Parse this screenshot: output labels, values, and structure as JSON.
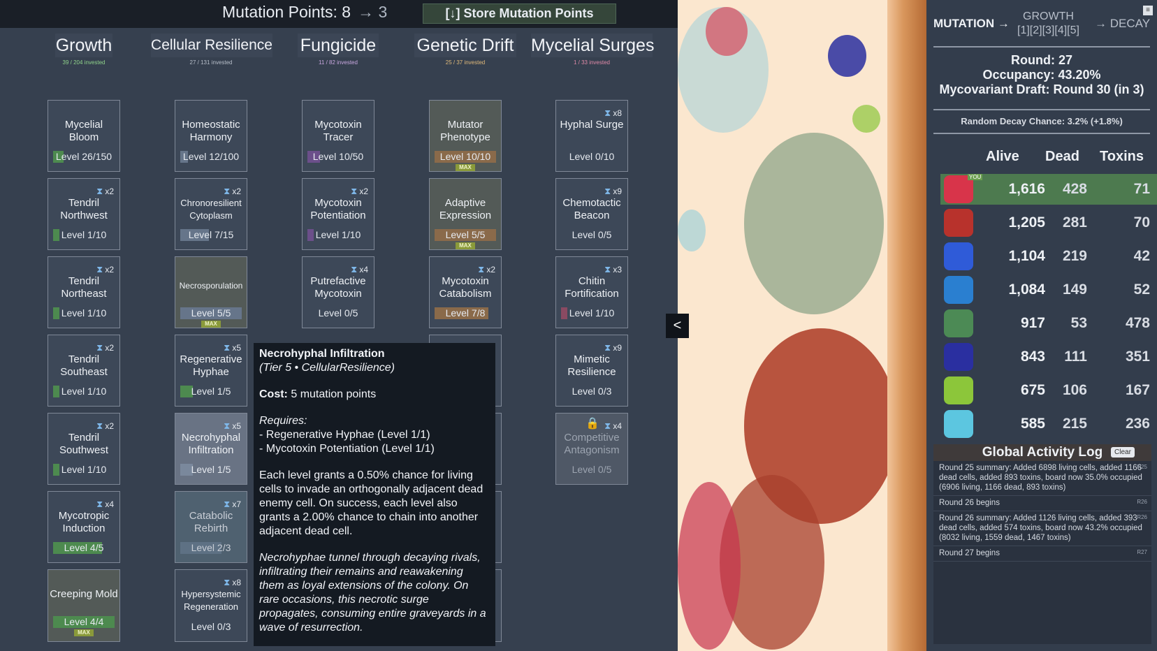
{
  "topbar": {
    "mutation_points_label": "Mutation Points: 8",
    "mutation_points_after": "→ 3",
    "store_button": "[↓] Store Mutation Points"
  },
  "columns": [
    {
      "title": "Growth",
      "invested": "39 / 204 invested",
      "color": "#8fd28a"
    },
    {
      "title": "Cellular Resilience",
      "invested": "27 / 131 invested",
      "color": "#b8bfca"
    },
    {
      "title": "Fungicide",
      "invested": "11 / 82 invested",
      "color": "#c9a7e0"
    },
    {
      "title": "Genetic Drift",
      "invested": "25 / 37 invested",
      "color": "#e0b97a"
    },
    {
      "title": "Mycelial Surges",
      "invested": "1 / 33 invested",
      "color": "#e08aa8"
    }
  ],
  "cards": {
    "growth": [
      {
        "name": "Mycelial Bloom",
        "level": "Level 26/150",
        "progress": 0.17,
        "cost": ""
      },
      {
        "name": "Tendril Northwest",
        "level": "Level 1/10",
        "progress": 0.1,
        "cost": "x2"
      },
      {
        "name": "Tendril Northeast",
        "level": "Level 1/10",
        "progress": 0.1,
        "cost": "x2"
      },
      {
        "name": "Tendril Southeast",
        "level": "Level 1/10",
        "progress": 0.1,
        "cost": "x2"
      },
      {
        "name": "Tendril Southwest",
        "level": "Level 1/10",
        "progress": 0.1,
        "cost": "x2"
      },
      {
        "name": "Mycotropic Induction",
        "level": "Level 4/5",
        "progress": 0.8,
        "cost": "x4"
      },
      {
        "name": "Creeping Mold",
        "level": "Level 4/4",
        "progress": 1.0,
        "cost": "",
        "max": "MAX"
      }
    ],
    "resilience": [
      {
        "name": "Homeostatic Harmony",
        "level": "Level 12/100",
        "progress": 0.12,
        "cost": ""
      },
      {
        "name": "Chronoresilient Cytoplasm",
        "level": "Level 7/15",
        "progress": 0.47,
        "cost": "x2"
      },
      {
        "name": "Necrosporulation",
        "level": "Level 5/5",
        "progress": 1.0,
        "cost": "",
        "max": "MAX"
      },
      {
        "name": "Regenerative Hyphae",
        "level": "Level 1/5",
        "progress": 0.2,
        "cost": "x5"
      },
      {
        "name": "Necrohyphal Infiltration",
        "level": "Level 1/5",
        "progress": 0.2,
        "cost": "x5"
      },
      {
        "name": "Catabolic Rebirth",
        "level": "Level 2/3",
        "progress": 0.67,
        "cost": "x7"
      },
      {
        "name": "Hypersystemic Regeneration",
        "level": "Level 0/3",
        "progress": 0,
        "cost": "x8"
      }
    ],
    "fungicide": [
      {
        "name": "Mycotoxin Tracer",
        "level": "Level 10/50",
        "progress": 0.2,
        "cost": ""
      },
      {
        "name": "Mycotoxin Potentiation",
        "level": "Level 1/10",
        "progress": 0.1,
        "cost": "x2"
      },
      {
        "name": "Putrefactive Mycotoxin",
        "level": "Level 0/5",
        "progress": 0,
        "cost": "x4"
      }
    ],
    "drift": [
      {
        "name": "Mutator Phenotype",
        "level": "Level 10/10",
        "progress": 1.0,
        "cost": "",
        "max": "MAX"
      },
      {
        "name": "Adaptive Expression",
        "level": "Level 5/5",
        "progress": 1.0,
        "cost": "",
        "max": "MAX"
      },
      {
        "name": "Mycotoxin Catabolism",
        "level": "Level 7/8",
        "progress": 0.88,
        "cost": "x2"
      }
    ],
    "surges": [
      {
        "name": "Hyphal Surge",
        "level": "Level 0/10",
        "progress": 0,
        "cost": "x8"
      },
      {
        "name": "Chemotactic Beacon",
        "level": "Level 0/5",
        "progress": 0,
        "cost": "x9"
      },
      {
        "name": "Chitin Fortification",
        "level": "Level 1/10",
        "progress": 0.1,
        "cost": "x3"
      },
      {
        "name": "Mimetic Resilience",
        "level": "Level 0/3",
        "progress": 0,
        "cost": "x9"
      },
      {
        "name": "Competitive Antagonism",
        "level": "Level 0/5",
        "progress": 0,
        "cost": "x4"
      }
    ]
  },
  "tooltip": {
    "title": "Necrohyphal Infiltration",
    "subtitle": "(Tier 5 • CellularResilience)",
    "cost_label": "Cost:",
    "cost_value": "5 mutation points",
    "requires_label": "Requires:",
    "req1": "- Regenerative Hyphae (Level 1/1)",
    "req2": "- Mycotoxin Potentiation (Level 1/1)",
    "desc": "Each level grants a 0.50% chance for living cells to invade an orthogonally adjacent dead enemy cell. On success, each level also grants a 2.00% chance to chain into another adjacent dead cell.",
    "flavor": "Necrohyphae tunnel through decaying rivals, infiltrating their remains and reawakening them as loyal extensions of the colony. On rare occasions, this necrotic surge propagates, consuming entire graveyards in a wave of resurrection."
  },
  "panel_toggle": "<",
  "sidebar": {
    "phase_mutation": "MUTATION",
    "phase_arrow": "→",
    "phase_growth": "GROWTH",
    "phase_growth_steps": "[1][2][3][4][5]",
    "phase_decay": "→ DECAY",
    "round": "Round: 27",
    "occupancy": "Occupancy: 43.20%",
    "draft": "Mycovariant Draft: Round 30 (in 3)",
    "decay_chance": "Random Decay Chance: 3.2% (+1.8%)",
    "headers": {
      "alive": "Alive",
      "dead": "Dead",
      "toxins": "Toxins"
    },
    "you_tag": "YOU",
    "players": [
      {
        "alive": "1,616",
        "dead": "428",
        "toxins": "71",
        "color": "#d8344a",
        "you": true
      },
      {
        "alive": "1,205",
        "dead": "281",
        "toxins": "70",
        "color": "#b8322c"
      },
      {
        "alive": "1,104",
        "dead": "219",
        "toxins": "42",
        "color": "#2f5bd8"
      },
      {
        "alive": "1,084",
        "dead": "149",
        "toxins": "52",
        "color": "#2a7fd0"
      },
      {
        "alive": "917",
        "dead": "53",
        "toxins": "478",
        "color": "#4c8a55"
      },
      {
        "alive": "843",
        "dead": "111",
        "toxins": "351",
        "color": "#2a2fa0"
      },
      {
        "alive": "675",
        "dead": "106",
        "toxins": "167",
        "color": "#8cc63a"
      },
      {
        "alive": "585",
        "dead": "215",
        "toxins": "236",
        "color": "#5cc6e0"
      }
    ],
    "log_title": "Global Activity Log",
    "log_clear": "Clear",
    "log": [
      {
        "text": "Round 25 summary: Added 6898 living cells, added 1166 dead cells, added 893 toxins, board now 35.0% occupied (6906 living, 1166 dead, 893 toxins)",
        "tag": "R25"
      },
      {
        "text": "Round 26 begins",
        "tag": "R26"
      },
      {
        "text": "Round 26 summary: Added 1126 living cells, added 393 dead cells, added 574 toxins, board now 43.2% occupied (8032 living, 1559 dead, 1467 toxins)",
        "tag": "R26"
      },
      {
        "text": "Round 27 begins",
        "tag": "R27"
      }
    ]
  }
}
